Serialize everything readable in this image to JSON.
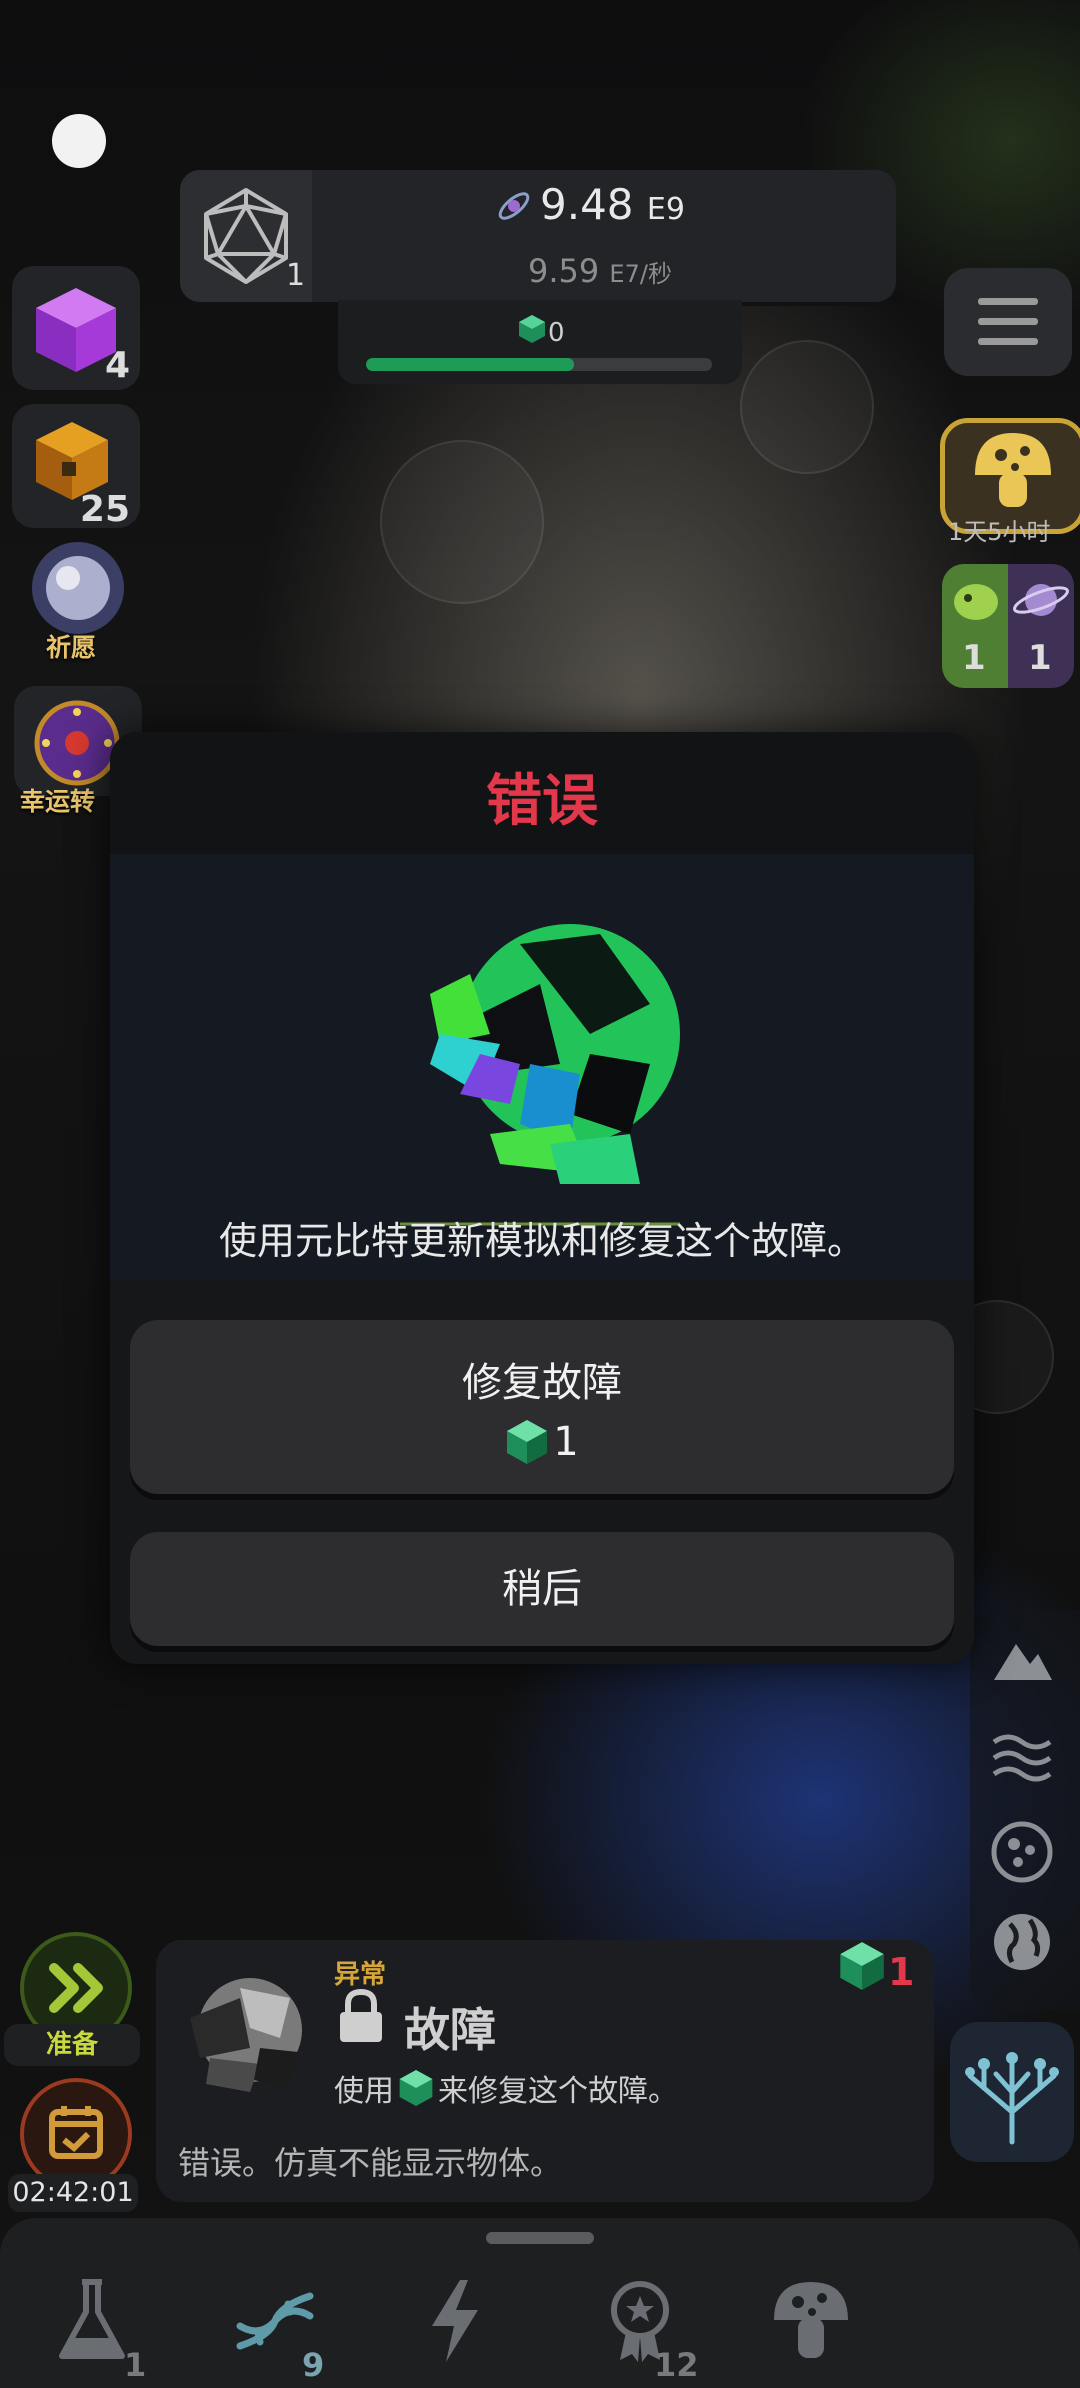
{
  "top_bar": {
    "level": "1",
    "resource_main": "9.48",
    "resource_main_unit": "E9",
    "resource_rate": "9.59",
    "resource_rate_unit": "E7/秒",
    "gem_count": "0",
    "progress_fraction": 0.6
  },
  "left_column": {
    "cube_count": "4",
    "puzzle_count": "25",
    "wish_label": "祈愿",
    "lucky_wheel_label": "幸运转"
  },
  "right_column": {
    "mushroom_timer": "1天5小时",
    "card_green_count": "1",
    "card_purple_count": "1"
  },
  "modal": {
    "title": "错误",
    "description": "使用元比特更新模拟和修复这个故障。",
    "fix_button_label": "修复故障",
    "fix_cost": "1",
    "later_button_label": "稍后"
  },
  "info_card": {
    "category": "异常",
    "name": "故障",
    "use_prefix": "使用",
    "use_suffix": "来修复这个故障。",
    "error_text": "错误。仿真不能显示物体。",
    "cost": "1"
  },
  "left_bottom": {
    "ready_label": "准备",
    "countdown": "02:42:01"
  },
  "bottom_nav": {
    "flask_count": "1",
    "dna_count": "9",
    "award_count": "12"
  },
  "colors": {
    "accent_red": "#e3374b",
    "progress_green": "#1f9b58",
    "gold": "#c8a437"
  }
}
